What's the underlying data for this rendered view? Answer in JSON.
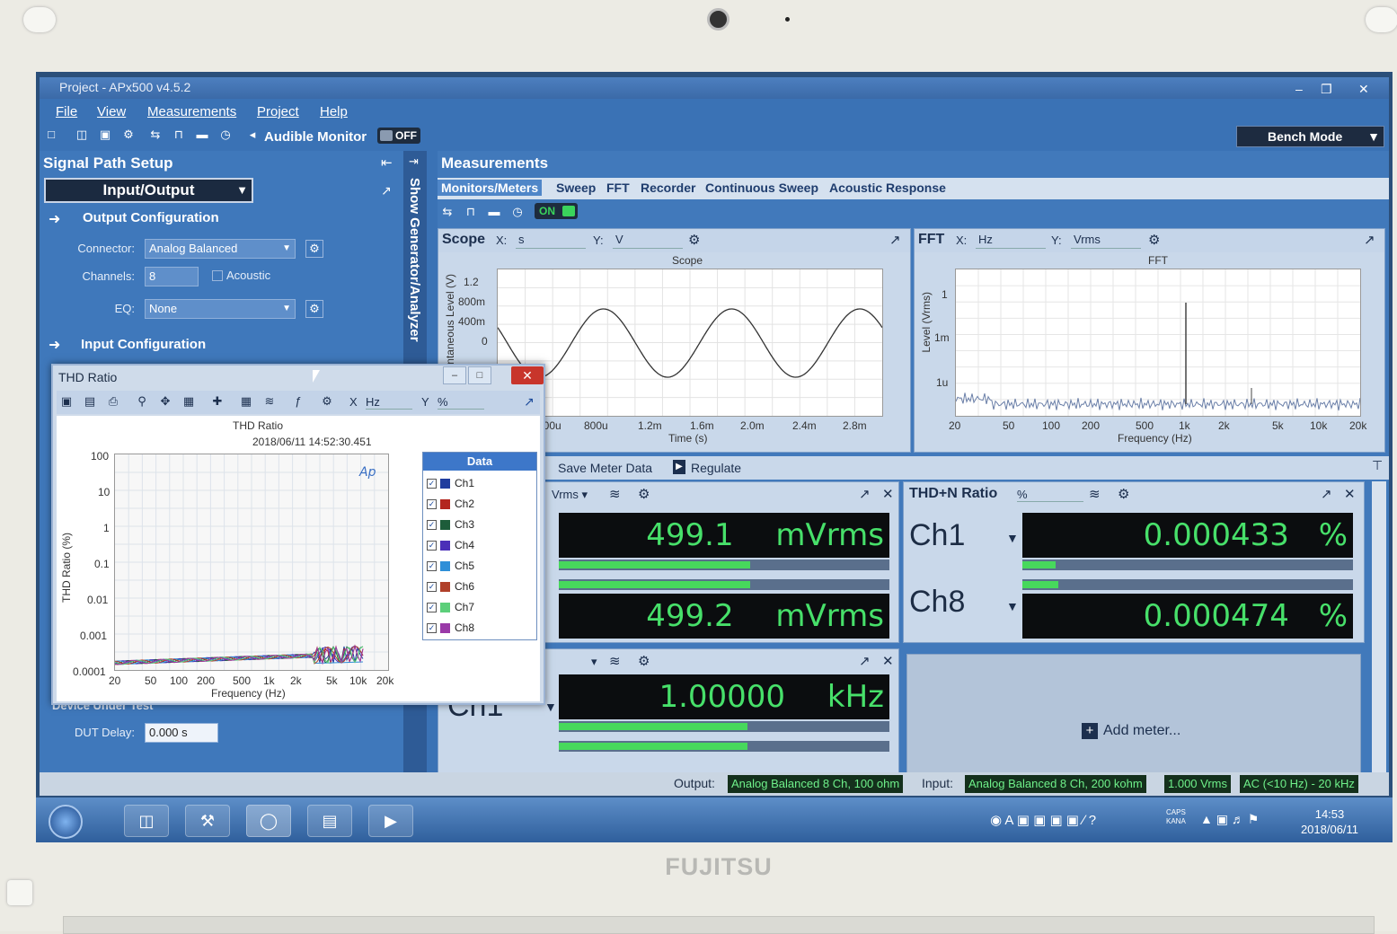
{
  "window": {
    "title": "Project - APx500 v4.5.2"
  },
  "menu": [
    "File",
    "View",
    "Measurements",
    "Project",
    "Help"
  ],
  "toolbar": {
    "audible_monitor": "Audible Monitor",
    "audible_state": "OFF",
    "bench_mode": "Bench Mode"
  },
  "signal_path": {
    "title": "Signal Path Setup",
    "mode": "Input/Output",
    "output_config": "Output Configuration",
    "connector_label": "Connector:",
    "connector_value": "Analog Balanced",
    "channels_label": "Channels:",
    "channels_value": "8",
    "acoustic_label": "Acoustic",
    "eq_label": "EQ:",
    "eq_value": "None",
    "input_config": "Input Configuration",
    "dut_section": "Device Under Test",
    "dut_delay_label": "DUT Delay:",
    "dut_delay_value": "0.000 s"
  },
  "side_tab": "Show Generator/Analyzer",
  "measurements": {
    "title": "Measurements",
    "tabs": [
      "Monitors/Meters",
      "Sweep",
      "FFT",
      "Recorder",
      "Continuous Sweep",
      "Acoustic Response"
    ],
    "on_label": "ON",
    "save_meter_data": "Save Meter Data",
    "regulate": "Regulate",
    "add_meter": "Add meter..."
  },
  "scope": {
    "name": "Scope",
    "x_label": "X:",
    "x_unit": "s",
    "y_label": "Y:",
    "y_unit": "V",
    "plot_title": "Scope",
    "ylabel": "Instantaneous Level (V)",
    "xlabel": "Time (s)",
    "yticks": [
      "1.2",
      "800m",
      "400m",
      "0"
    ],
    "xticks": [
      "400u",
      "800u",
      "1.2m",
      "1.6m",
      "2.0m",
      "2.4m",
      "2.8m"
    ]
  },
  "fft": {
    "name": "FFT",
    "x_label": "X:",
    "x_unit": "Hz",
    "y_label": "Y:",
    "y_unit": "Vrms",
    "plot_title": "FFT",
    "ylabel": "Level (Vrms)",
    "xlabel": "Frequency (Hz)",
    "yticks": [
      "1",
      "1m",
      "1u"
    ],
    "xticks": [
      "20",
      "50",
      "100",
      "200",
      "500",
      "1k",
      "2k",
      "5k",
      "10k",
      "20k"
    ]
  },
  "meters": {
    "rms_unit_sel": "Vrms",
    "rms_ch1_value": "499.1",
    "rms_ch1_unit": "mVrms",
    "rms_ch1_bar": 0.58,
    "rms_ch8_value": "499.2",
    "rms_ch8_unit": "mVrms",
    "rms_ch8_bar": 0.58,
    "thdn_title": "THD+N Ratio",
    "thdn_unit_sel": "%",
    "thdn_ch1_label": "Ch1",
    "thdn_ch1_value": "0.000433",
    "thdn_ch1_unit": "%",
    "thdn_ch1_bar": 0.1,
    "thdn_ch8_label": "Ch8",
    "thdn_ch8_value": "0.000474",
    "thdn_ch8_unit": "%",
    "thdn_ch8_bar": 0.11,
    "freq_ch_label": "Ch1",
    "freq_value": "1.00000",
    "freq_unit": "kHz",
    "freq_bar": 0.57
  },
  "thd_window": {
    "title": "THD Ratio",
    "x_label": "X",
    "x_unit": "Hz",
    "y_label": "Y",
    "y_unit": "%",
    "plot_title": "THD Ratio",
    "timestamp": "2018/06/11 14:52:30.451",
    "ylabel": "THD Ratio (%)",
    "xlabel": "Frequency (Hz)",
    "yticks": [
      "100",
      "10",
      "1",
      "0.1",
      "0.01",
      "0.001",
      "0.0001"
    ],
    "xticks": [
      "20",
      "50",
      "100",
      "200",
      "500",
      "1k",
      "2k",
      "5k",
      "10k",
      "20k"
    ],
    "legend_title": "Data",
    "channels": [
      {
        "name": "Ch1",
        "color": "#1f3c9e"
      },
      {
        "name": "Ch2",
        "color": "#b3261e"
      },
      {
        "name": "Ch3",
        "color": "#1d5c3a"
      },
      {
        "name": "Ch4",
        "color": "#4b2fb8"
      },
      {
        "name": "Ch5",
        "color": "#2e8fd8"
      },
      {
        "name": "Ch6",
        "color": "#b0402a"
      },
      {
        "name": "Ch7",
        "color": "#5ccf7a"
      },
      {
        "name": "Ch8",
        "color": "#9a3aa8"
      }
    ]
  },
  "status": {
    "output_label": "Output:",
    "output_value": "Analog Balanced 8 Ch, 100 ohm",
    "input_label": "Input:",
    "input_value": "Analog Balanced 8 Ch, 200 kohm",
    "level": "1.000 Vrms",
    "bandwidth": "AC (<10 Hz) - 20 kHz"
  },
  "taskbar": {
    "time": "14:53",
    "date": "2018/06/11",
    "caps": "CAPS",
    "kana": "KANA"
  },
  "brand": "FUJITSU",
  "chart_data": [
    {
      "type": "line",
      "title": "Scope",
      "xlabel": "Time (s)",
      "ylabel": "Instantaneous Level (V)",
      "series": [
        {
          "values_note": "",
          "x": [
            0,
            0.0005,
            0.001,
            0.0015,
            0.002,
            0.0025,
            0.003
          ],
          "y": [
            0.5,
            0,
            -0.5,
            0,
            0.5,
            0,
            -0.5
          ]
        }
      ]
    },
    {
      "type": "line",
      "title": "FFT",
      "xlabel": "Frequency (Hz)",
      "ylabel": "Level (Vrms)",
      "series": [
        {
          "x": [
            1000,
            2000,
            3000
          ],
          "y": [
            0.5,
            1e-06,
            5e-07
          ]
        }
      ]
    },
    {
      "type": "line",
      "title": "THD Ratio",
      "xlabel": "Frequency (Hz)",
      "ylabel": "THD Ratio (%)",
      "ylim": [
        0.0001,
        100
      ],
      "series": [
        {
          "name": "Ch1",
          "x": [
            20,
            100,
            1000,
            10000
          ],
          "y": [
            0.0002,
            0.0003,
            0.0004,
            0.0006
          ]
        }
      ]
    }
  ]
}
